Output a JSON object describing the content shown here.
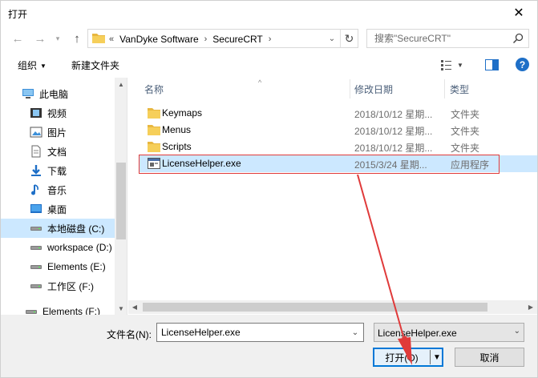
{
  "window": {
    "title": "打开"
  },
  "nav": {
    "back_icon": "arrow-left-icon",
    "forward_icon": "arrow-right-icon",
    "up_icon": "arrow-up-icon"
  },
  "address": {
    "overflow": "«",
    "crumbs": [
      "VanDyke Software",
      "SecureCRT"
    ]
  },
  "search": {
    "placeholder": "搜索\"SecureCRT\""
  },
  "toolbar": {
    "organize_label": "组织",
    "new_folder_label": "新建文件夹"
  },
  "sidebar": {
    "items": [
      {
        "label": "此电脑",
        "icon": "computer-icon"
      },
      {
        "label": "视频",
        "icon": "video-icon"
      },
      {
        "label": "图片",
        "icon": "pictures-icon"
      },
      {
        "label": "文档",
        "icon": "documents-icon"
      },
      {
        "label": "下载",
        "icon": "download-icon"
      },
      {
        "label": "音乐",
        "icon": "music-icon"
      },
      {
        "label": "桌面",
        "icon": "desktop-icon"
      },
      {
        "label": "本地磁盘 (C:)",
        "icon": "drive-icon"
      },
      {
        "label": "workspace (D:)",
        "icon": "drive-icon"
      },
      {
        "label": "Elements (E:)",
        "icon": "drive-icon"
      },
      {
        "label": "工作区 (F:)",
        "icon": "drive-icon"
      },
      {
        "label": "Elements (F:)",
        "icon": "drive-icon"
      }
    ],
    "selected_index": 7
  },
  "columns": {
    "name": "名称",
    "date": "修改日期",
    "type": "类型"
  },
  "files": [
    {
      "name": "Keymaps",
      "date": "2018/10/12 星期...",
      "type": "文件夹",
      "icon": "folder-icon"
    },
    {
      "name": "Menus",
      "date": "2018/10/12 星期...",
      "type": "文件夹",
      "icon": "folder-icon"
    },
    {
      "name": "Scripts",
      "date": "2018/10/12 星期...",
      "type": "文件夹",
      "icon": "folder-icon"
    },
    {
      "name": "LicenseHelper.exe",
      "date": "2015/3/24 星期...",
      "type": "应用程序",
      "icon": "exe-icon"
    }
  ],
  "selected_file_index": 3,
  "bottom": {
    "filename_label": "文件名(N):",
    "filename_value": "LicenseHelper.exe",
    "filter_value": "LicenseHelper.exe",
    "open_label": "打开(O)",
    "cancel_label": "取消"
  },
  "colors": {
    "selection": "#cce8ff",
    "accent": "#0078d7",
    "annotation": "#e03a3a",
    "folder": "#e8b740"
  }
}
